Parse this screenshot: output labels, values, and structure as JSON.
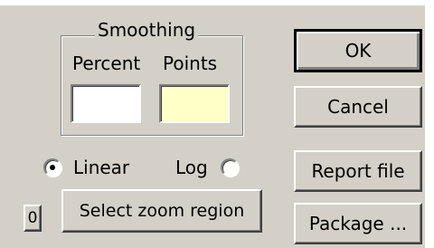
{
  "smoothing": {
    "title": "Smoothing",
    "percent_label": "Percent",
    "points_label": "Points",
    "percent_value": "",
    "points_value": ""
  },
  "scale": {
    "options": [
      {
        "label": "Linear",
        "selected": true
      },
      {
        "label": "Log",
        "selected": false
      }
    ]
  },
  "buttons": {
    "ok": "OK",
    "cancel": "Cancel",
    "report_file": "Report file",
    "package": "Package ...",
    "select_zoom_region": "Select zoom region",
    "zero": "0"
  },
  "colors": {
    "dialog_face": "#d4d0c8",
    "points_field": "#ffffc8",
    "percent_field": "#ffffff"
  }
}
